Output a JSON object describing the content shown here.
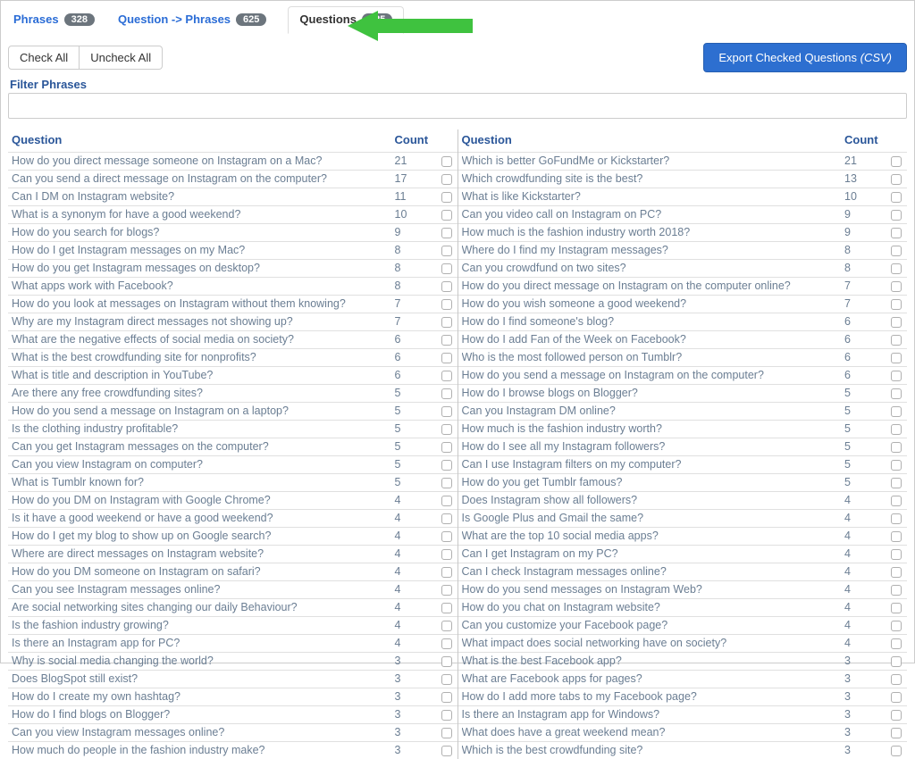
{
  "tabs": [
    {
      "label": "Phrases",
      "badge": "328",
      "active": false
    },
    {
      "label": "Question -> Phrases",
      "badge": "625",
      "active": false
    },
    {
      "label": "Questions",
      "badge": "625",
      "active": true
    }
  ],
  "buttons": {
    "check_all": "Check All",
    "uncheck_all": "Uncheck All",
    "export_prefix": "Export Checked Questions ",
    "export_suffix": "(CSV)"
  },
  "filter": {
    "label": "Filter Phrases",
    "value": ""
  },
  "headers": {
    "question": "Question",
    "count": "Count"
  },
  "columns": [
    [
      {
        "q": "How do you direct message someone on Instagram on a Mac?",
        "c": "21"
      },
      {
        "q": "Can you send a direct message on Instagram on the computer?",
        "c": "17"
      },
      {
        "q": "Can I DM on Instagram website?",
        "c": "11"
      },
      {
        "q": "What is a synonym for have a good weekend?",
        "c": "10"
      },
      {
        "q": "How do you search for blogs?",
        "c": "9"
      },
      {
        "q": "How do I get Instagram messages on my Mac?",
        "c": "8"
      },
      {
        "q": "How do you get Instagram messages on desktop?",
        "c": "8"
      },
      {
        "q": "What apps work with Facebook?",
        "c": "8"
      },
      {
        "q": "How do you look at messages on Instagram without them knowing?",
        "c": "7"
      },
      {
        "q": "Why are my Instagram direct messages not showing up?",
        "c": "7"
      },
      {
        "q": "What are the negative effects of social media on society?",
        "c": "6"
      },
      {
        "q": "What is the best crowdfunding site for nonprofits?",
        "c": "6"
      },
      {
        "q": "What is title and description in YouTube?",
        "c": "6"
      },
      {
        "q": "Are there any free crowdfunding sites?",
        "c": "5"
      },
      {
        "q": "How do you send a message on Instagram on a laptop?",
        "c": "5"
      },
      {
        "q": "Is the clothing industry profitable?",
        "c": "5"
      },
      {
        "q": "Can you get Instagram messages on the computer?",
        "c": "5"
      },
      {
        "q": "Can you view Instagram on computer?",
        "c": "5"
      },
      {
        "q": "What is Tumblr known for?",
        "c": "5"
      },
      {
        "q": "How do you DM on Instagram with Google Chrome?",
        "c": "4"
      },
      {
        "q": "Is it have a good weekend or have a good weekend?",
        "c": "4"
      },
      {
        "q": "How do I get my blog to show up on Google search?",
        "c": "4"
      },
      {
        "q": "Where are direct messages on Instagram website?",
        "c": "4"
      },
      {
        "q": "How do you DM someone on Instagram on safari?",
        "c": "4"
      },
      {
        "q": "Can you see Instagram messages online?",
        "c": "4"
      },
      {
        "q": "Are social networking sites changing our daily Behaviour?",
        "c": "4"
      },
      {
        "q": "Is the fashion industry growing?",
        "c": "4"
      },
      {
        "q": "Is there an Instagram app for PC?",
        "c": "4"
      },
      {
        "q": "Why is social media changing the world?",
        "c": "3"
      },
      {
        "q": "Does BlogSpot still exist?",
        "c": "3"
      },
      {
        "q": "How do I create my own hashtag?",
        "c": "3"
      },
      {
        "q": "How do I find blogs on Blogger?",
        "c": "3"
      },
      {
        "q": "Can you view Instagram messages online?",
        "c": "3"
      },
      {
        "q": "How much do people in the fashion industry make?",
        "c": "3"
      }
    ],
    [
      {
        "q": "Which is better GoFundMe or Kickstarter?",
        "c": "21"
      },
      {
        "q": "Which crowdfunding site is the best?",
        "c": "13"
      },
      {
        "q": "What is like Kickstarter?",
        "c": "10"
      },
      {
        "q": "Can you video call on Instagram on PC?",
        "c": "9"
      },
      {
        "q": "How much is the fashion industry worth 2018?",
        "c": "9"
      },
      {
        "q": "Where do I find my Instagram messages?",
        "c": "8"
      },
      {
        "q": "Can you crowdfund on two sites?",
        "c": "8"
      },
      {
        "q": "How do you direct message on Instagram on the computer online?",
        "c": "7"
      },
      {
        "q": "How do you wish someone a good weekend?",
        "c": "7"
      },
      {
        "q": "How do I find someone's blog?",
        "c": "6"
      },
      {
        "q": "How do I add Fan of the Week on Facebook?",
        "c": "6"
      },
      {
        "q": "Who is the most followed person on Tumblr?",
        "c": "6"
      },
      {
        "q": "How do you send a message on Instagram on the computer?",
        "c": "6"
      },
      {
        "q": "How do I browse blogs on Blogger?",
        "c": "5"
      },
      {
        "q": "Can you Instagram DM online?",
        "c": "5"
      },
      {
        "q": "How much is the fashion industry worth?",
        "c": "5"
      },
      {
        "q": "How do I see all my Instagram followers?",
        "c": "5"
      },
      {
        "q": "Can I use Instagram filters on my computer?",
        "c": "5"
      },
      {
        "q": "How do you get Tumblr famous?",
        "c": "5"
      },
      {
        "q": "Does Instagram show all followers?",
        "c": "4"
      },
      {
        "q": "Is Google Plus and Gmail the same?",
        "c": "4"
      },
      {
        "q": "What are the top 10 social media apps?",
        "c": "4"
      },
      {
        "q": "Can I get Instagram on my PC?",
        "c": "4"
      },
      {
        "q": "Can I check Instagram messages online?",
        "c": "4"
      },
      {
        "q": "How do you send messages on Instagram Web?",
        "c": "4"
      },
      {
        "q": "How do you chat on Instagram website?",
        "c": "4"
      },
      {
        "q": "Can you customize your Facebook page?",
        "c": "4"
      },
      {
        "q": "What impact does social networking have on society?",
        "c": "4"
      },
      {
        "q": "What is the best Facebook app?",
        "c": "3"
      },
      {
        "q": "What are Facebook apps for pages?",
        "c": "3"
      },
      {
        "q": "How do I add more tabs to my Facebook page?",
        "c": "3"
      },
      {
        "q": "Is there an Instagram app for Windows?",
        "c": "3"
      },
      {
        "q": "What does have a great weekend mean?",
        "c": "3"
      },
      {
        "q": "Which is the best crowdfunding site?",
        "c": "3"
      }
    ]
  ]
}
